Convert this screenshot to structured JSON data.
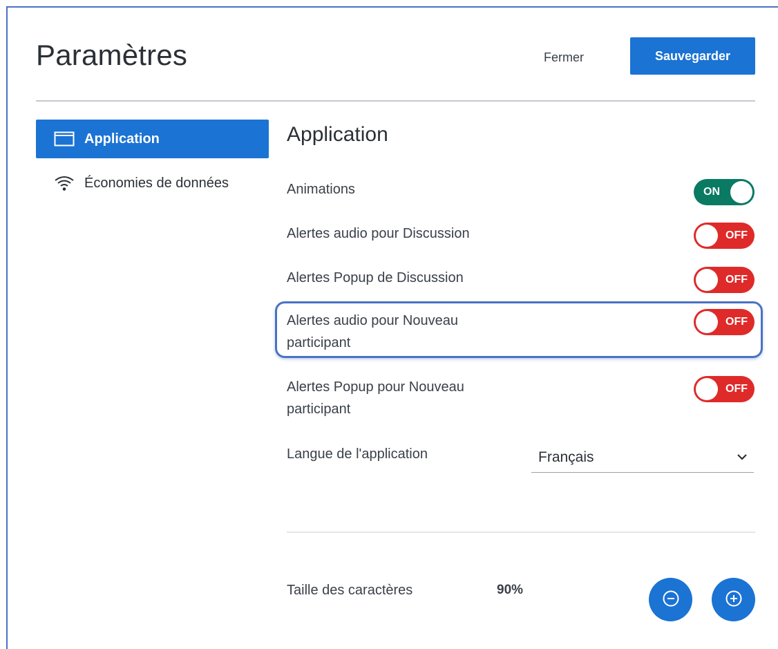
{
  "header": {
    "title": "Paramètres",
    "close_label": "Fermer",
    "save_label": "Sauvegarder"
  },
  "sidebar": {
    "items": [
      {
        "label": "Application",
        "icon": "window-icon",
        "active": true
      },
      {
        "label": "Économies de données",
        "icon": "wifi-icon",
        "active": false
      }
    ]
  },
  "main": {
    "section_title": "Application",
    "settings": [
      {
        "label": "Animations",
        "state": "ON"
      },
      {
        "label": "Alertes audio pour Discussion",
        "state": "OFF"
      },
      {
        "label": "Alertes Popup de Discussion",
        "state": "OFF"
      },
      {
        "label": "Alertes audio pour Nouveau participant",
        "state": "OFF"
      },
      {
        "label": "Alertes Popup pour Nouveau participant",
        "state": "OFF"
      }
    ],
    "language": {
      "label": "Langue de l'application",
      "value": "Français"
    },
    "font_size": {
      "label": "Taille des caractères",
      "value": "90%"
    }
  },
  "colors": {
    "accent": "#1b73d4",
    "toggle_on": "#0a7a63",
    "toggle_off": "#df2a2a",
    "highlight_border": "#4a72c4"
  }
}
